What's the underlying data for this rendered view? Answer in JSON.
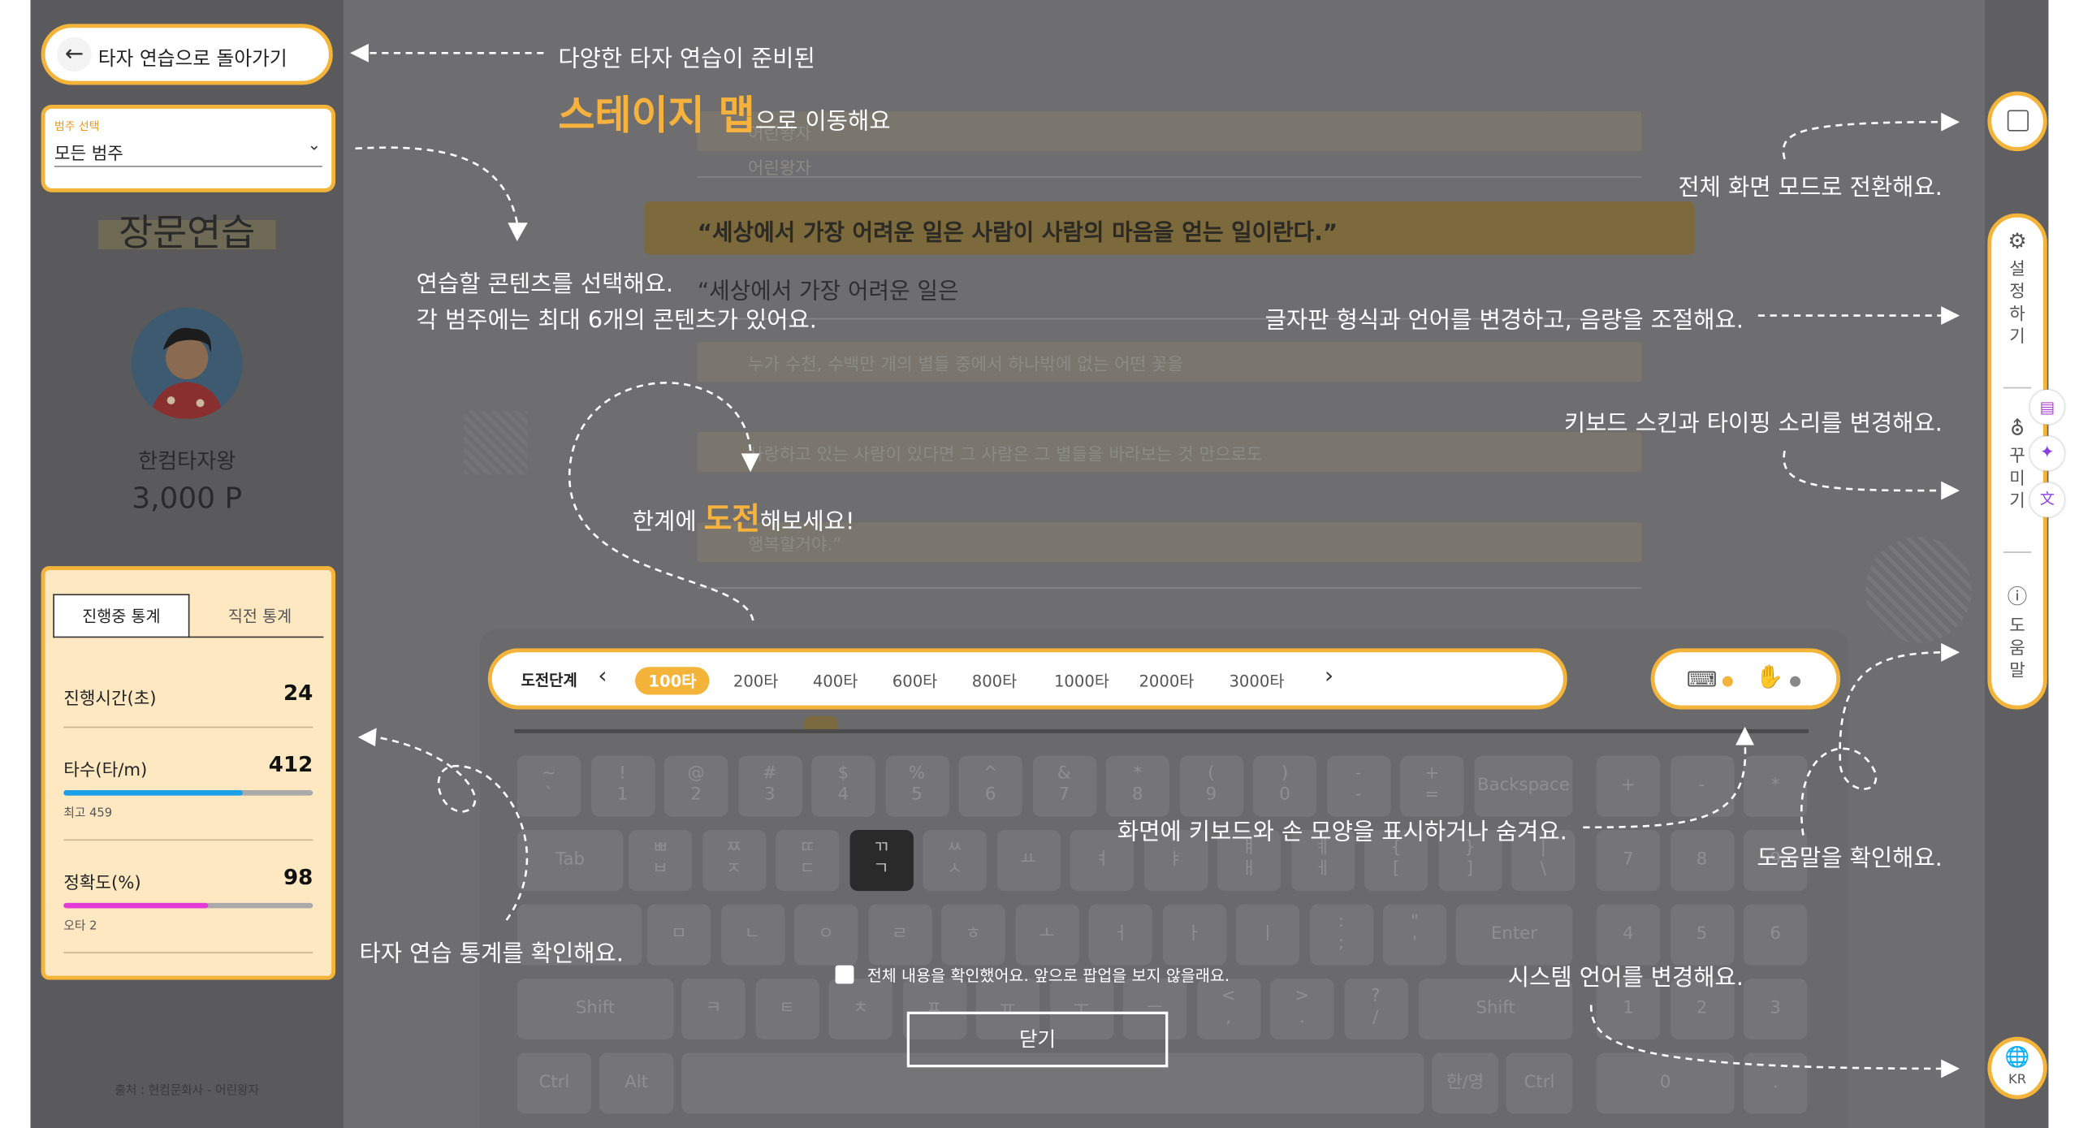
{
  "left": {
    "back_button": "타자 연습으로 돌아가기",
    "category_label": "범주 선택",
    "category_value": "모든 범주",
    "title": "장문연습",
    "username": "한컴타자왕",
    "points": "3,000 P",
    "stats_tabs": [
      "진행중 통계",
      "직전 통계"
    ],
    "stats": {
      "time_label": "진행시간(초)",
      "time_value": "24",
      "speed_label": "타수(타/m)",
      "speed_value": "412",
      "speed_sub": "최고 459",
      "speed_progress": 0.72,
      "accuracy_label": "정확도(%)",
      "accuracy_value": "98",
      "accuracy_sub": "오타 2",
      "accuracy_progress": 0.58
    },
    "source": "출처 : 현컴문화사 - 어린왕자"
  },
  "content": {
    "book_title": "어린왕자",
    "book_subtitle": "어린왕자",
    "quote": "“세상에서 가장 어려운 일은 사람이 사람의 마음을 얻는 일이란다.”",
    "typed": "“세상에서 가장 어려운 일은",
    "line3": "누가 수천, 수백만 개의 별들 중에서 하나밖에 없는 어떤 꽃을",
    "line4": "사랑하고 있는 사람이 있다면 그 사람은 그 별들을 바라보는 것 만으로도",
    "line5": "행복할거야.”"
  },
  "levels": {
    "label": "도전단계",
    "items": [
      "100타",
      "200타",
      "400타",
      "600타",
      "800타",
      "1000타",
      "2000타",
      "3000타"
    ],
    "selected_index": 0
  },
  "right_rail": {
    "settings": [
      "설",
      "정",
      "하",
      "기"
    ],
    "decorate": [
      "꾸",
      "미",
      "기"
    ],
    "help": [
      "도",
      "움",
      "말"
    ],
    "language": "KR"
  },
  "keyboard": {
    "row1": [
      "~\n`",
      "!\n1",
      "@\n2",
      "#\n3",
      "$\n4",
      "%\n5",
      "^\n6",
      "&\n7",
      "*\n8",
      "(\n9",
      ")\n0",
      "-\n-",
      "+\n="
    ],
    "row2": [
      "ㅃ\nㅂ",
      "ㅉ\nㅈ",
      "ㄸ\nㄷ",
      "ㄲ\nㄱ",
      "ㅆ\nㅅ",
      "ㅛ",
      "ㅕ",
      "ㅑ",
      "ㅒ\nㅐ",
      "ㅖ\nㅔ",
      "{\n[",
      "}\n]",
      "|\n\\"
    ],
    "row3": [
      "ㅁ",
      "ㄴ",
      "ㅇ",
      "ㄹ",
      "ㅎ",
      "ㅗ",
      "ㅓ",
      "ㅏ",
      "ㅣ",
      ":\n;",
      "\"\n'"
    ],
    "row4": [
      "ㅋ",
      "ㅌ",
      "ㅊ",
      "ㅍ",
      "ㅠ",
      "ㅜ",
      "ㅡ",
      "<\n,",
      ">\n.",
      "?\n/"
    ],
    "active_key": "ㄲ\nㄱ",
    "specials": {
      "backspace": "Backspace",
      "tab": "Tab",
      "enter": "Enter",
      "shift": "Shift",
      "ctrl": "Ctrl",
      "alt": "Alt",
      "hanyoung": "한/영"
    },
    "numpad_top": [
      "+",
      "-",
      "*"
    ],
    "numpad": [
      "7",
      "8",
      "9",
      "4",
      "5",
      "6",
      "1",
      "2",
      "3",
      "0",
      "."
    ]
  },
  "tutorial": {
    "note_stage_1": "다양한 타자 연습이 준비된",
    "note_stage_2_em": "스테이지 맵",
    "note_stage_2": "으로 이동해요",
    "note_content_1": "연습할 콘텐츠를 선택해요.",
    "note_content_2": "각 범주에는 최대 6개의 콘텐츠가 있어요.",
    "note_challenge_pre": "한계에 ",
    "note_challenge_em": "도전",
    "note_challenge_post": "해보세요!",
    "note_stats": "타자 연습 통계를 확인해요.",
    "note_fullscreen": "전체 화면 모드로 전환해요.",
    "note_settings": "글자판 형식과 언어를 변경하고, 음량을 조절해요.",
    "note_decorate": "키보드 스킨과 타이핑 소리를 변경해요.",
    "note_keyboard": "화면에 키보드와 손 모양을 표시하거나 숨겨요.",
    "note_help": "도움말을 확인해요.",
    "note_language": "시스템 언어를 변경해요.",
    "dont_show": "전체 내용을 확인했어요. 앞으로 팝업을 보지 않을래요.",
    "close": "닫기"
  },
  "colors": {
    "accent": "#f4b43a",
    "speed_bar": "#1aa0e8",
    "accuracy_bar": "#e63ad8",
    "overlay": "#6b6b6d"
  }
}
